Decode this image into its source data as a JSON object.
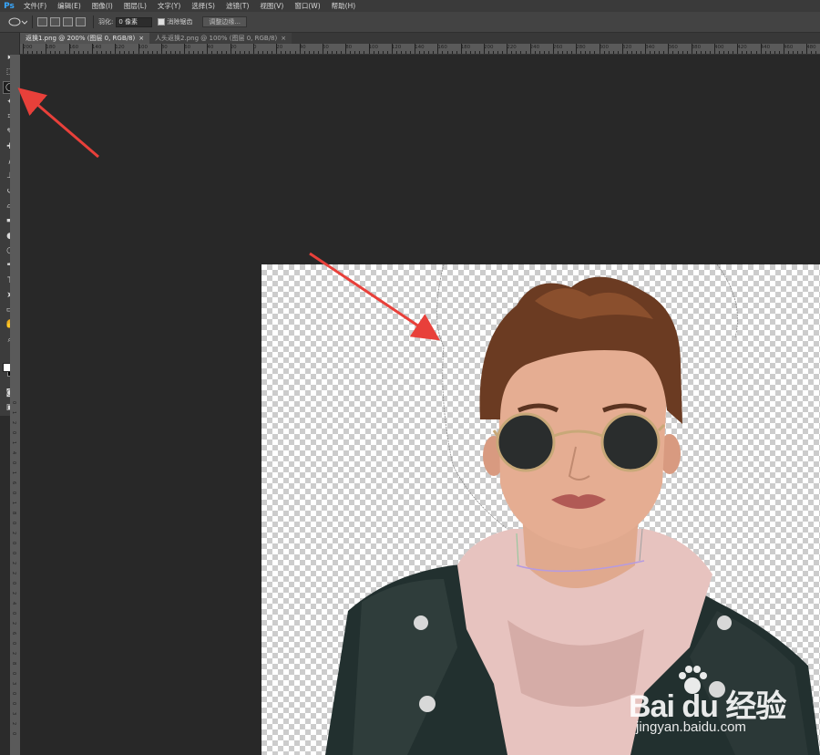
{
  "app": {
    "logo": "Ps"
  },
  "menu": [
    "文件(F)",
    "编辑(E)",
    "图像(I)",
    "图层(L)",
    "文字(Y)",
    "选择(S)",
    "滤镜(T)",
    "视图(V)",
    "窗口(W)",
    "帮助(H)"
  ],
  "options": {
    "feather_label": "羽化:",
    "feather_value": "0 像素",
    "antialias_label": "消除锯齿",
    "refine_edge_label": "调整边缘..."
  },
  "tabs": [
    {
      "label": "返换1.png @ 200% (图层 0, RGB/8)",
      "close": "×"
    },
    {
      "label": "人头返换2.png @ 100% (图层 0, RGB/8)",
      "close": "×"
    }
  ],
  "ruler_h": [
    "200",
    "180",
    "160",
    "140",
    "120",
    "100",
    "80",
    "60",
    "40",
    "20",
    "0",
    "20",
    "40",
    "60",
    "80",
    "100",
    "120",
    "140",
    "160",
    "180",
    "200",
    "220",
    "240",
    "260",
    "280",
    "300",
    "320",
    "340",
    "360",
    "380",
    "400",
    "420",
    "440",
    "460",
    "480"
  ],
  "ruler_v": [
    "0",
    "1",
    "2",
    "0",
    "1",
    "4",
    "0",
    "1",
    "6",
    "0",
    "1",
    "8",
    "0",
    "2",
    "0",
    "0",
    "2",
    "2",
    "0",
    "2",
    "4",
    "0",
    "2",
    "6",
    "0",
    "2",
    "8",
    "0",
    "3",
    "0",
    "0",
    "3",
    "2",
    "0"
  ],
  "tools": [
    {
      "name": "move-tool-icon",
      "glyph": "▸"
    },
    {
      "name": "marquee-tool-icon",
      "glyph": "⬚"
    },
    {
      "name": "lasso-tool-icon",
      "glyph": "◯"
    },
    {
      "name": "quick-select-tool-icon",
      "glyph": "✦"
    },
    {
      "name": "crop-tool-icon",
      "glyph": "⌗"
    },
    {
      "name": "eyedropper-tool-icon",
      "glyph": "✎"
    },
    {
      "name": "healing-tool-icon",
      "glyph": "✚"
    },
    {
      "name": "brush-tool-icon",
      "glyph": "/"
    },
    {
      "name": "stamp-tool-icon",
      "glyph": "⊥"
    },
    {
      "name": "history-brush-tool-icon",
      "glyph": "↺"
    },
    {
      "name": "eraser-tool-icon",
      "glyph": "▱"
    },
    {
      "name": "gradient-tool-icon",
      "glyph": "▬"
    },
    {
      "name": "blur-tool-icon",
      "glyph": "●"
    },
    {
      "name": "dodge-tool-icon",
      "glyph": "◔"
    },
    {
      "name": "pen-tool-icon",
      "glyph": "✒"
    },
    {
      "name": "type-tool-icon",
      "glyph": "T"
    },
    {
      "name": "path-select-tool-icon",
      "glyph": "➤"
    },
    {
      "name": "shape-tool-icon",
      "glyph": "▭"
    },
    {
      "name": "hand-tool-icon",
      "glyph": "✋"
    },
    {
      "name": "zoom-tool-icon",
      "glyph": "⌕"
    }
  ],
  "colors": {
    "foreground": "#ffffff",
    "background": "#000000",
    "arrow": "#e8403a"
  },
  "watermark": {
    "main": "Bai du 经验",
    "sub": "jingyan.baidu.com"
  }
}
